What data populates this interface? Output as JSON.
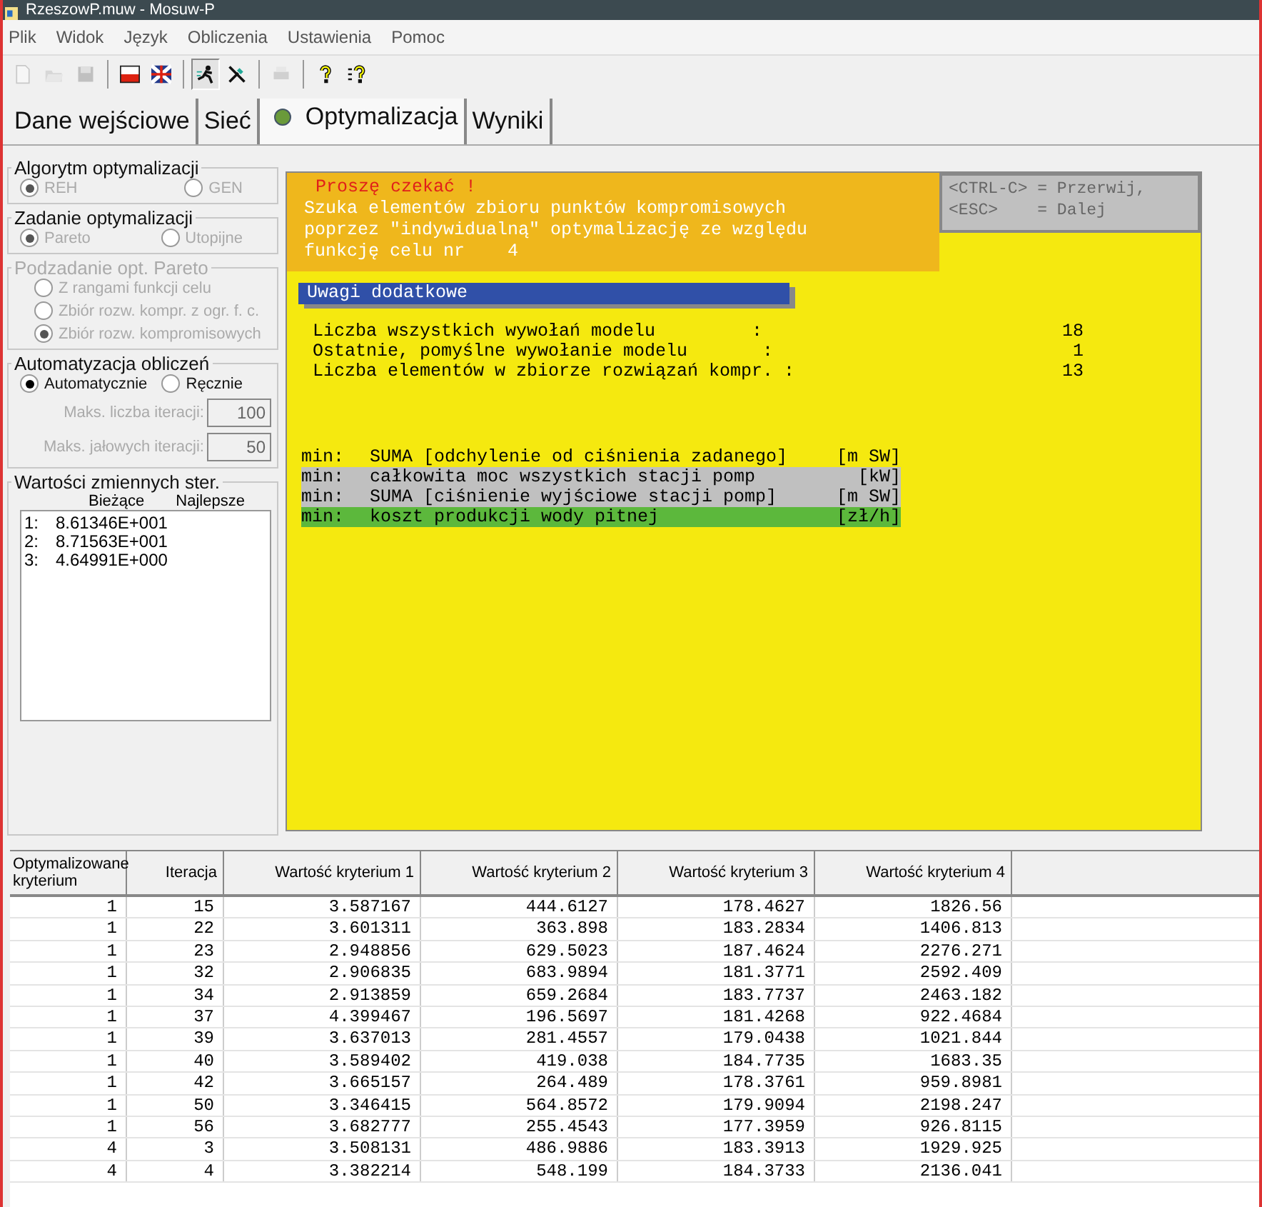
{
  "window": {
    "title": "RzeszowP.muw - Mosuw-P"
  },
  "menu": [
    "Plik",
    "Widok",
    "Język",
    "Obliczenia",
    "Ustawienia",
    "Pomoc"
  ],
  "toolbar": [
    {
      "kind": "new",
      "disabled": true,
      "pressed": false
    },
    {
      "kind": "open",
      "disabled": true,
      "pressed": false
    },
    {
      "kind": "save",
      "disabled": true,
      "pressed": false
    },
    {
      "kind": "sep"
    },
    {
      "kind": "flag-pl",
      "disabled": false,
      "pressed": false
    },
    {
      "kind": "flag-uk",
      "disabled": false,
      "pressed": false
    },
    {
      "kind": "sep"
    },
    {
      "kind": "run",
      "disabled": false,
      "pressed": true
    },
    {
      "kind": "stop",
      "disabled": false,
      "pressed": false
    },
    {
      "kind": "sep"
    },
    {
      "kind": "print",
      "disabled": true,
      "pressed": false
    },
    {
      "kind": "sep"
    },
    {
      "kind": "help",
      "disabled": false,
      "pressed": false
    },
    {
      "kind": "help-list",
      "disabled": false,
      "pressed": false
    }
  ],
  "tabs": [
    {
      "label": "Dane wejściowe",
      "selected": false,
      "dot": false
    },
    {
      "label": "Sieć",
      "selected": false,
      "dot": false
    },
    {
      "label": "Optymalizacja",
      "selected": true,
      "dot": true
    },
    {
      "label": "Wyniki",
      "selected": false,
      "dot": false
    }
  ],
  "groups": [
    {
      "title": "Algorytm optymalizacji",
      "disabled": false,
      "options": [
        {
          "label": "REH",
          "selected": true,
          "disabled": true
        },
        {
          "label": "GEN",
          "selected": false,
          "disabled": true
        }
      ]
    },
    {
      "title": "Zadanie optymalizacji",
      "disabled": false,
      "options": [
        {
          "label": "Pareto",
          "selected": true,
          "disabled": true
        },
        {
          "label": "Utopijne",
          "selected": false,
          "disabled": true
        }
      ]
    },
    {
      "title": "Podzadanie opt. Pareto",
      "disabled": true,
      "options": [
        {
          "label": "Z  rangami funkcji celu",
          "selected": false,
          "disabled": true
        },
        {
          "label": "Zbiór rozw. kompr. z ogr. f. c.",
          "selected": false,
          "disabled": true
        },
        {
          "label": "Zbiór rozw. kompromisowych",
          "selected": true,
          "disabled": true
        }
      ]
    },
    {
      "title": "Automatyzacja obliczeń",
      "disabled": false,
      "options": [
        {
          "label": "Automatycznie",
          "selected": true,
          "disabled": false
        },
        {
          "label": "Ręcznie",
          "selected": false,
          "disabled": false
        }
      ],
      "fields": [
        {
          "label": "Maks. liczba iteracji:",
          "value": "100",
          "disabled": true
        },
        {
          "label": "Maks. jałowych iteracji:",
          "value": "50",
          "disabled": true
        }
      ]
    }
  ],
  "variables": {
    "title": "Wartości zmiennych ster.",
    "headers": [
      "Bieżące",
      "Najlepsze"
    ],
    "items": [
      {
        "index": "1:",
        "value": "8.61346E+001"
      },
      {
        "index": "2:",
        "value": "8.71563E+001"
      },
      {
        "index": "3:",
        "value": "4.64991E+000"
      }
    ]
  },
  "console": {
    "wait": "Proszę czekać !",
    "message": [
      "Szuka elementów zbioru punktów kompromisowych",
      "poprzez \"indywidualną\" optymalizację ze względu",
      "funkcję celu nr    4"
    ],
    "keys": [
      "<CTRL-C> = Przerwij,",
      "<ESC>    = Dalej"
    ],
    "notes_title": "Uwagi dodatkowe",
    "stats": [
      {
        "label": "Liczba wszystkich wywołań modelu         :",
        "value": "18"
      },
      {
        "label": "Ostatnie, pomyślne wywołanie modelu       :",
        "value": "1"
      },
      {
        "label": "Liczba elementów w zbiorze rozwiązań kompr. :",
        "value": "13"
      }
    ],
    "objectives": [
      {
        "prefix": "min:",
        "text": "SUMA [odchylenie od ciśnienia zadanego]",
        "unit": "[m SW]"
      },
      {
        "prefix": "min:",
        "text": "całkowita moc wszystkich stacji pomp",
        "unit": "[kW]",
        "color": "#c0c0c0"
      },
      {
        "prefix": "min:",
        "text": "SUMA [ciśnienie wyjściowe stacji pomp]",
        "unit": "[m SW]",
        "color": "#c0c0c0"
      },
      {
        "prefix": "min:",
        "text": "koszt produkcji wody pitnej",
        "unit": "[zł/h]",
        "color": "#5cb83c"
      }
    ]
  },
  "table": {
    "columns": [
      "Optymalizowane kryterium",
      "Iteracja",
      "Wartość kryterium 1",
      "Wartość kryterium 2",
      "Wartość kryterium 3",
      "Wartość kryterium 4"
    ],
    "rows": [
      [
        "1",
        "15",
        "3.587167",
        "444.6127",
        "178.4627",
        "1826.56"
      ],
      [
        "1",
        "22",
        "3.601311",
        "363.898",
        "183.2834",
        "1406.813"
      ],
      [
        "1",
        "23",
        "2.948856",
        "629.5023",
        "187.4624",
        "2276.271"
      ],
      [
        "1",
        "32",
        "2.906835",
        "683.9894",
        "181.3771",
        "2592.409"
      ],
      [
        "1",
        "34",
        "2.913859",
        "659.2684",
        "183.7737",
        "2463.182"
      ],
      [
        "1",
        "37",
        "4.399467",
        "196.5697",
        "181.4268",
        "922.4684"
      ],
      [
        "1",
        "39",
        "3.637013",
        "281.4557",
        "179.0438",
        "1021.844"
      ],
      [
        "1",
        "40",
        "3.589402",
        "419.038",
        "184.7735",
        "1683.35"
      ],
      [
        "1",
        "42",
        "3.665157",
        "264.489",
        "178.3761",
        "959.8981"
      ],
      [
        "1",
        "50",
        "3.346415",
        "564.8572",
        "179.9094",
        "2198.247"
      ],
      [
        "1",
        "56",
        "3.682777",
        "255.4543",
        "177.3959",
        "926.8115"
      ],
      [
        "4",
        "3",
        "3.508131",
        "486.9886",
        "183.3913",
        "1929.925"
      ],
      [
        "4",
        "4",
        "3.382214",
        "548.199",
        "184.3733",
        "2136.041"
      ]
    ]
  }
}
